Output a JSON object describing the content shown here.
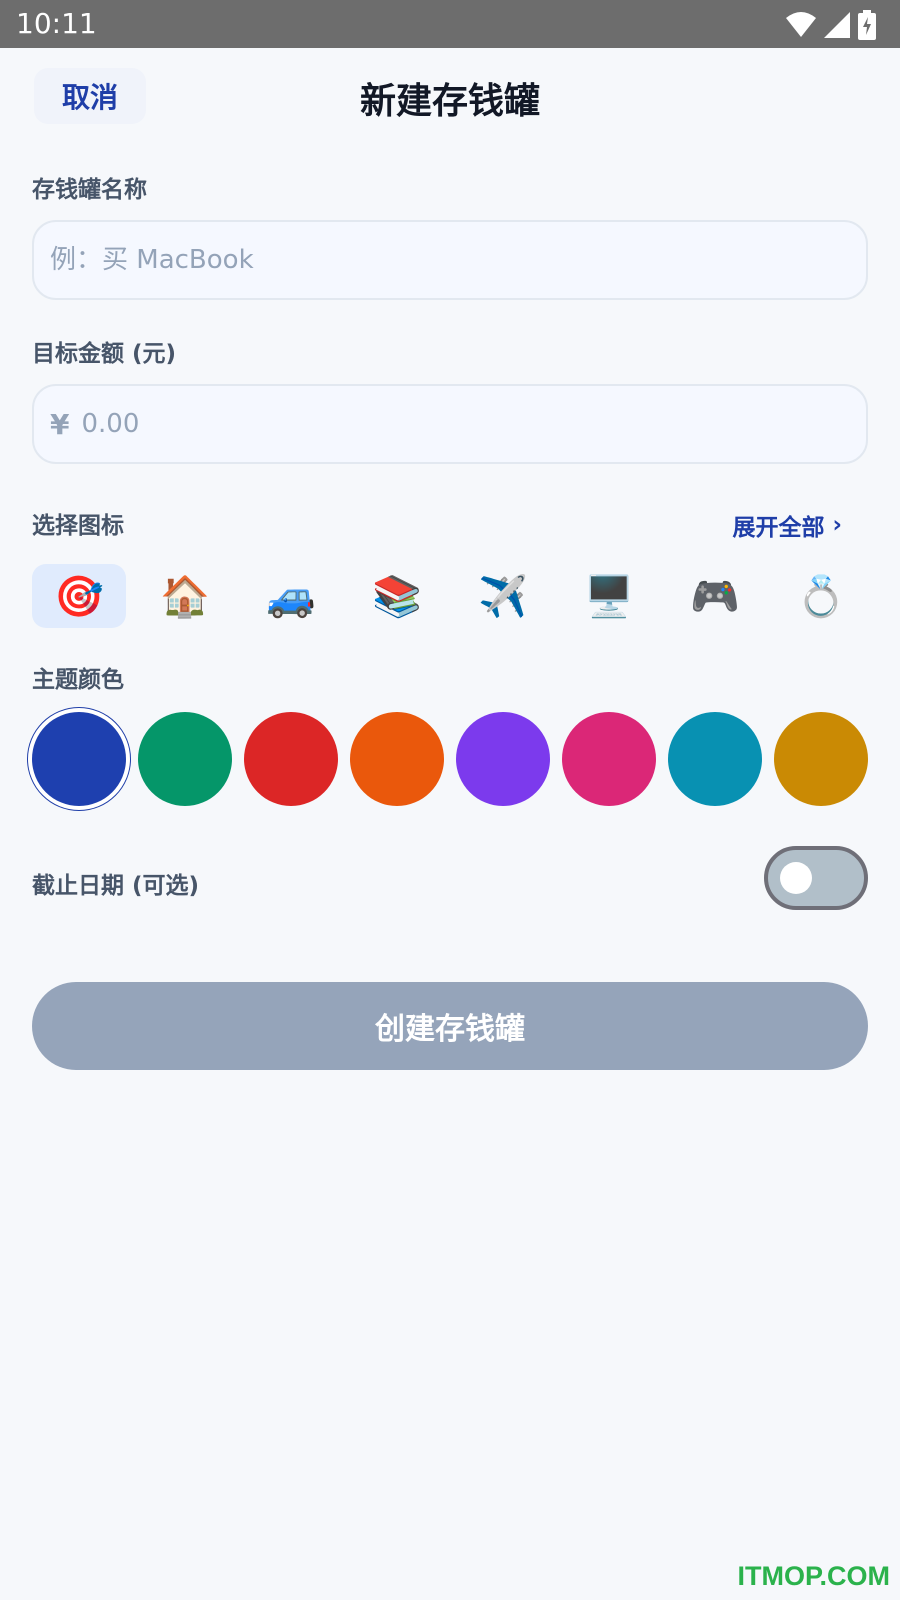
{
  "status_bar": {
    "time": "10:11",
    "icons": [
      "wifi-icon",
      "cellular-signal-icon",
      "battery-charging-icon"
    ]
  },
  "header": {
    "cancel_label": "取消",
    "title": "新建存钱罐"
  },
  "form": {
    "name": {
      "label": "存钱罐名称",
      "placeholder": "例：买 MacBook",
      "value": ""
    },
    "amount": {
      "label": "目标金额 (元)",
      "currency": "¥",
      "placeholder": "0.00",
      "value": ""
    },
    "icons": {
      "label": "选择图标",
      "expand_label": "展开全部",
      "expand_chevron": "›",
      "items": [
        {
          "name": "target-icon",
          "glyph": "🎯",
          "selected": true
        },
        {
          "name": "house-icon",
          "glyph": "🏠",
          "selected": false
        },
        {
          "name": "car-icon",
          "glyph": "🚙",
          "selected": false
        },
        {
          "name": "books-icon",
          "glyph": "📚",
          "selected": false
        },
        {
          "name": "airplane-icon",
          "glyph": "✈️",
          "selected": false
        },
        {
          "name": "computer-icon",
          "glyph": "🖥️",
          "selected": false
        },
        {
          "name": "game-controller-icon",
          "glyph": "🎮",
          "selected": false
        },
        {
          "name": "ring-icon",
          "glyph": "💍",
          "selected": false
        }
      ]
    },
    "theme_colors": {
      "label": "主题颜色",
      "options": [
        {
          "color": "#1e40af",
          "selected": true
        },
        {
          "color": "#059669",
          "selected": false
        },
        {
          "color": "#dc2626",
          "selected": false
        },
        {
          "color": "#ea580c",
          "selected": false
        },
        {
          "color": "#7c3aed",
          "selected": false
        },
        {
          "color": "#db2777",
          "selected": false
        },
        {
          "color": "#0891b2",
          "selected": false
        },
        {
          "color": "#ca8a04",
          "selected": false
        }
      ]
    },
    "deadline": {
      "label": "截止日期 (可选)",
      "enabled": false
    },
    "submit_label": "创建存钱罐"
  },
  "watermark": "ITMOP.COM"
}
